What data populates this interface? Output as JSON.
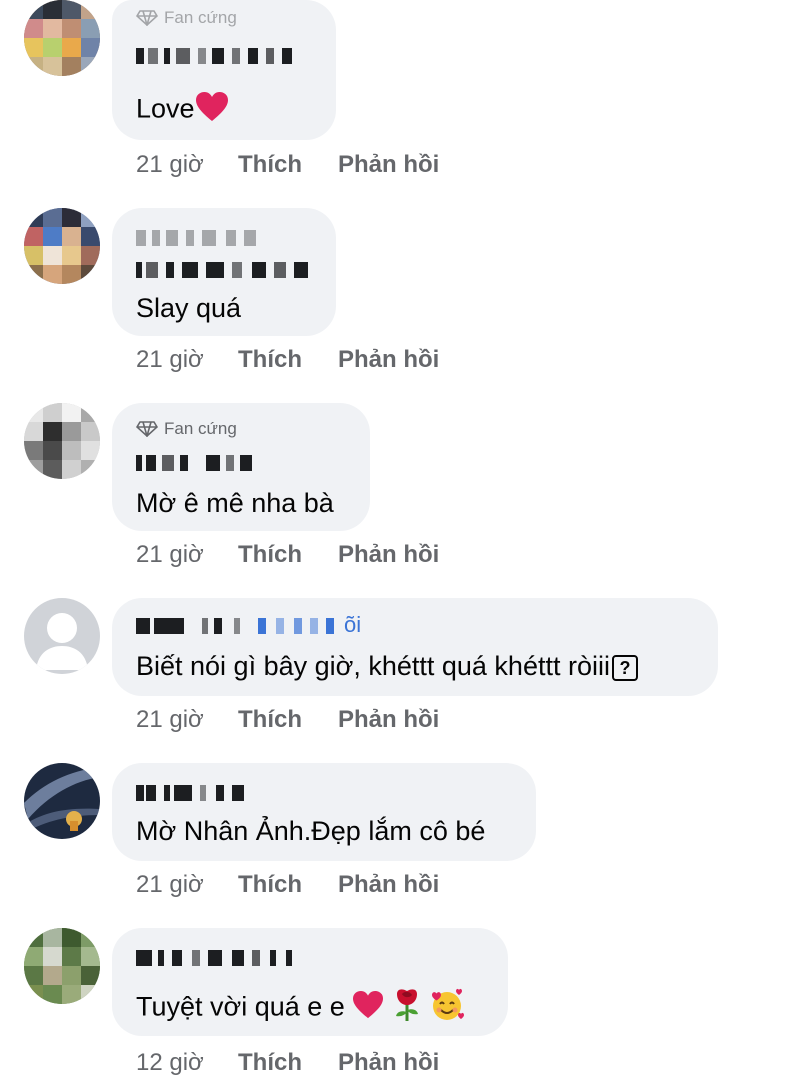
{
  "comments": [
    {
      "badge": "Fan cứng",
      "text": "Love",
      "emojis": [
        "heart-emoji"
      ],
      "time": "21 giờ",
      "like": "Thích",
      "reply": "Phản hồi"
    },
    {
      "text": "Slay quá",
      "time": "21 giờ",
      "like": "Thích",
      "reply": "Phản hồi"
    },
    {
      "badge": "Fan cứng",
      "text": "Mờ ê mê nha bà",
      "time": "21 giờ",
      "like": "Thích",
      "reply": "Phản hồi"
    },
    {
      "name_suffix": "õi",
      "text": "Biết nói gì bây giờ, khéttt quá khéttt ròiii",
      "emojis": [
        "unknown-glyph"
      ],
      "time": "21 giờ",
      "like": "Thích",
      "reply": "Phản hồi"
    },
    {
      "text": "Mờ Nhân Ảnh.Đẹp lắm cô bé",
      "time": "21 giờ",
      "like": "Thích",
      "reply": "Phản hồi"
    },
    {
      "text": "Tuyệt vời quá e e",
      "emojis": [
        "heart-emoji",
        "rose-emoji",
        "smiling-hearts-emoji"
      ],
      "time": "12 giờ",
      "like": "Thích",
      "reply": "Phản hồi"
    }
  ],
  "colors": {
    "bubble": "#f0f2f5",
    "meta": "#65676b",
    "text": "#050505",
    "heart": "#e0245e",
    "link": "#3b74d6"
  }
}
